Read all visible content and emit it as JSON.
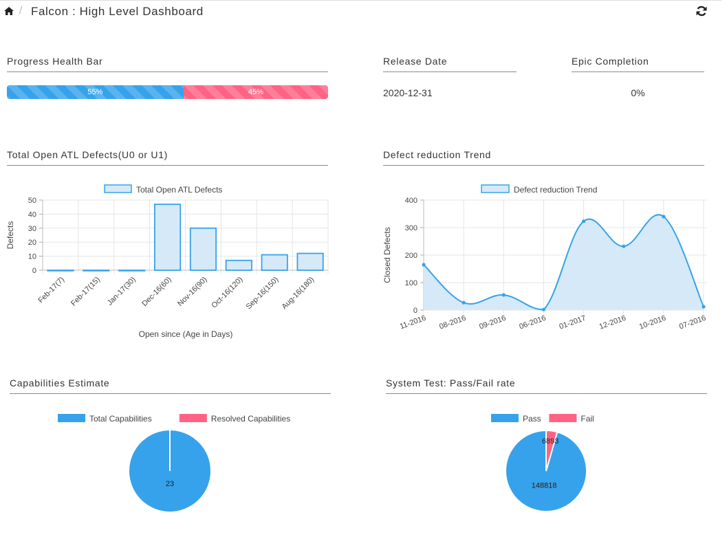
{
  "header": {
    "separator": "/",
    "title": "Falcon : High Level Dashboard"
  },
  "progress": {
    "title": "Progress Health Bar",
    "pass_percent": 55,
    "fail_percent": 45,
    "pass_label": "55%",
    "fail_label": "45%"
  },
  "release": {
    "title": "Release Date",
    "value": "2020-12-31"
  },
  "epic": {
    "title": "Epic Completion",
    "value": "0%"
  },
  "defects_section": {
    "title": "Total Open ATL Defects(U0 or U1)"
  },
  "trend_section": {
    "title": "Defect reduction Trend"
  },
  "capabilities_section": {
    "title": "Capabilities Estimate"
  },
  "systemtest_section": {
    "title": "System Test: Pass/Fail rate"
  },
  "colors": {
    "blue": "#36a2eb",
    "blue_fill": "#d6e9f8",
    "pink": "#ff6384"
  },
  "chart_data": [
    {
      "type": "bar",
      "legend": "Total Open ATL Defects",
      "categories": [
        "Feb-17(7)",
        "Feb-17(15)",
        "Jan-17(30)",
        "Dec-16(60)",
        "Nov-16(90)",
        "Oct-16(120)",
        "Sep-16(150)",
        "Aug-16(180)"
      ],
      "values": [
        0,
        0,
        0,
        47,
        30,
        7,
        11,
        12
      ],
      "ylabel": "Defects",
      "xlabel": "Open since (Age in Days)",
      "ylim": [
        0,
        50
      ],
      "yticks": [
        0,
        10,
        20,
        30,
        40,
        50
      ],
      "grid": true,
      "legend_position": "top"
    },
    {
      "type": "area",
      "legend": "Defect reduction Trend",
      "categories": [
        "11-2016",
        "08-2016",
        "09-2016",
        "06-2016",
        "01-2017",
        "12-2016",
        "10-2016",
        "07-2016"
      ],
      "values": [
        165,
        27,
        55,
        2,
        323,
        232,
        340,
        12
      ],
      "ylabel": "Closed Defects",
      "ylim": [
        0,
        400
      ],
      "yticks": [
        0,
        100,
        200,
        300,
        400
      ],
      "grid": true,
      "legend_position": "top"
    },
    {
      "type": "pie",
      "labels": [
        "Total Capabilities",
        "Resolved Capabilities"
      ],
      "values": [
        23,
        0
      ],
      "value_labels": [
        "23",
        ""
      ],
      "legend_position": "top"
    },
    {
      "type": "pie",
      "labels": [
        "Pass",
        "Fail"
      ],
      "values": [
        148818,
        6893
      ],
      "value_labels": [
        "148818",
        "6893"
      ],
      "legend_position": "top"
    }
  ]
}
